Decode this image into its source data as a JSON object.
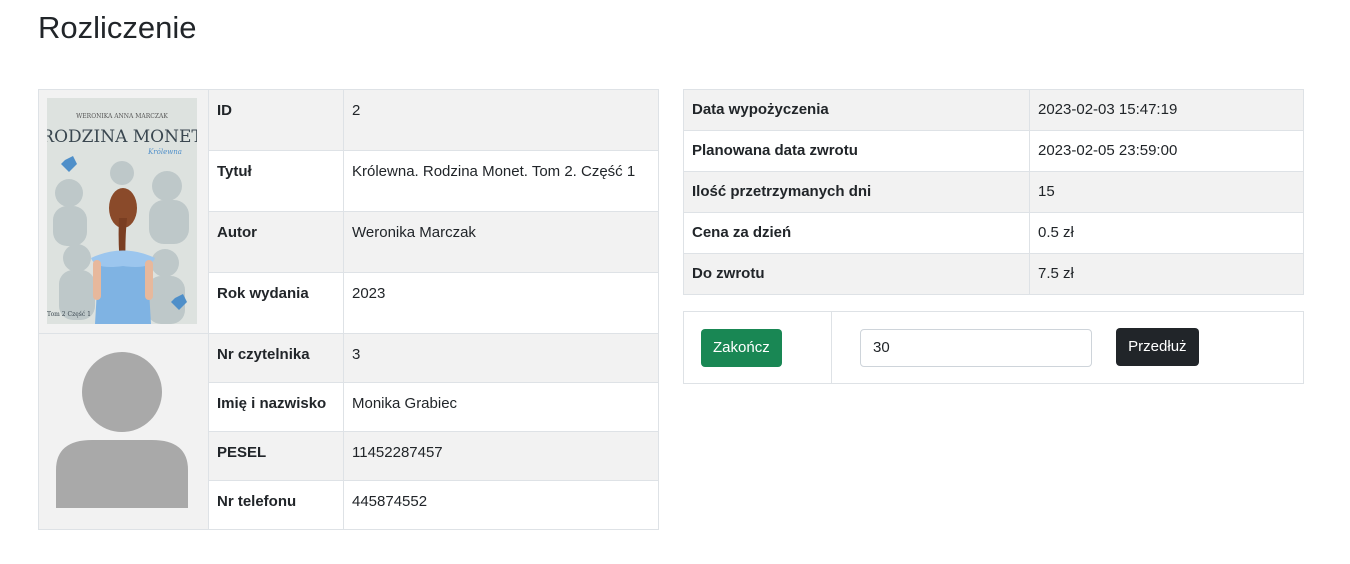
{
  "page": {
    "title": "Rozliczenie"
  },
  "book": {
    "cover": {
      "author_line": "WERONIKA ANNA MARCZAK",
      "title": "RODZINA MONET",
      "subtitle": "Królewna",
      "volume": "Tom 2 Część 1"
    },
    "rows": [
      {
        "label": "ID",
        "value": "2"
      },
      {
        "label": "Tytuł",
        "value": "Królewna. Rodzina Monet. Tom 2. Część 1"
      },
      {
        "label": "Autor",
        "value": "Weronika Marczak"
      },
      {
        "label": "Rok wydania",
        "value": "2023"
      }
    ]
  },
  "reader": {
    "rows": [
      {
        "label": "Nr czytelnika",
        "value": "3"
      },
      {
        "label": "Imię i nazwisko",
        "value": "Monika Grabiec"
      },
      {
        "label": "PESEL",
        "value": "11452287457"
      },
      {
        "label": "Nr telefonu",
        "value": "445874552"
      }
    ]
  },
  "loan": {
    "rows": [
      {
        "label": "Data wypożyczenia",
        "value": "2023-02-03 15:47:19"
      },
      {
        "label": "Planowana data zwrotu",
        "value": "2023-02-05 23:59:00"
      },
      {
        "label": "Ilość przetrzymanych dni",
        "value": "15"
      },
      {
        "label": "Cena za dzień",
        "value": "0.5 zł"
      },
      {
        "label": "Do zwrotu",
        "value": "7.5 zł"
      }
    ]
  },
  "actions": {
    "finish_label": "Zakończ",
    "extend_days_value": "30",
    "extend_label": "Przedłuż"
  },
  "colors": {
    "success": "#198754",
    "dark": "#212529",
    "row_shade": "#f2f2f2",
    "border": "#dee2e6"
  }
}
